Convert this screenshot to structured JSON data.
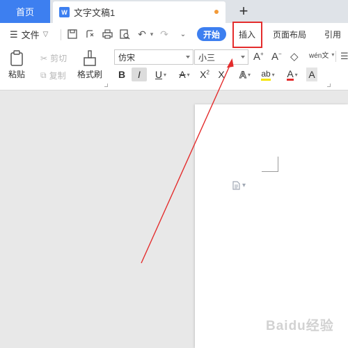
{
  "tabs": {
    "home_label": "首页",
    "doc_title": "文字文稿1",
    "doc_icon": "W",
    "new_tab_glyph": "+"
  },
  "menu": {
    "file_label": "文件",
    "tabs": [
      "开始",
      "插入",
      "页面布局",
      "引用"
    ]
  },
  "toolbar": {
    "paste_label": "粘贴",
    "cut_label": "剪切",
    "copy_label": "复制",
    "format_painter_label": "格式刷",
    "font_name": "仿宋",
    "font_size": "小三",
    "pinyin_glyph": "wén文"
  },
  "colors": {
    "accent": "#3d7ff0",
    "highlight_box": "#e42c2c",
    "arrow": "#e42c2c"
  },
  "watermark": "Baidu经验"
}
